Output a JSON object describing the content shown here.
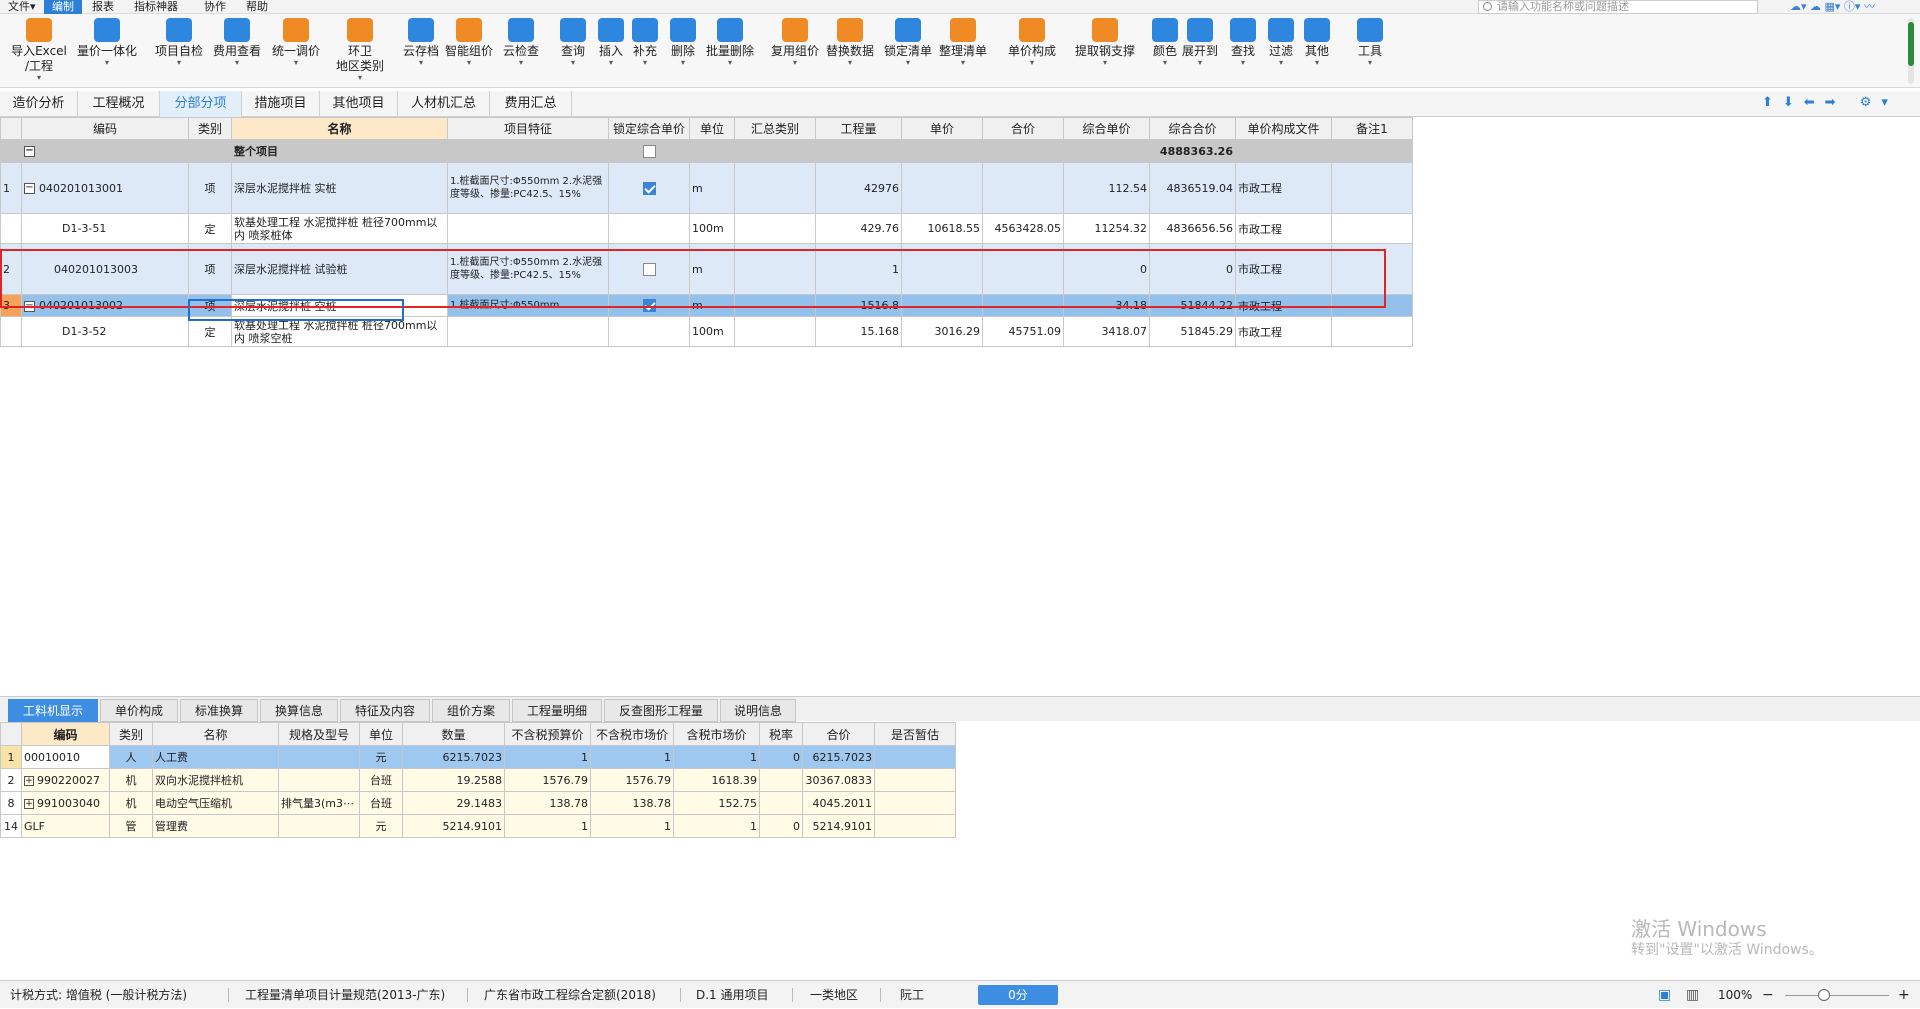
{
  "menu": [
    "文件▾",
    "编制",
    "报表",
    "指标神器",
    "协作",
    "帮助"
  ],
  "search": {
    "placeholder": "请输入功能名称或问题描述"
  },
  "ribbon": [
    {
      "label": "导入Excel",
      "label2": "/工程",
      "icon": "import-excel-icon",
      "color": "orange"
    },
    {
      "label": "量价一体化",
      "icon": "price-integration-icon",
      "color": "blue"
    },
    {
      "label": "项目自检",
      "icon": "self-check-icon",
      "color": "blue"
    },
    {
      "label": "费用查看",
      "icon": "fee-view-icon",
      "color": "blue"
    },
    {
      "label": "统一调价",
      "icon": "adjust-price-icon",
      "color": "orange"
    },
    {
      "label": "环卫",
      "label2": "地区类别",
      "icon": "region-icon",
      "color": "orange"
    },
    {
      "label": "云存档",
      "icon": "cloud-save-icon",
      "color": "blue"
    },
    {
      "label": "智能组价",
      "icon": "smart-price-icon",
      "color": "orange"
    },
    {
      "label": "云检查",
      "icon": "cloud-check-icon",
      "color": "blue"
    },
    {
      "label": "查询",
      "icon": "query-icon",
      "color": "blue"
    },
    {
      "label": "插入",
      "icon": "insert-icon",
      "color": "blue"
    },
    {
      "label": "补充",
      "icon": "supplement-icon",
      "color": "blue"
    },
    {
      "label": "删除",
      "icon": "delete-icon",
      "color": "blue"
    },
    {
      "label": "批量删除",
      "icon": "batch-delete-icon",
      "color": "blue"
    },
    {
      "label": "复用组价",
      "icon": "reuse-price-icon",
      "color": "orange"
    },
    {
      "label": "替换数据",
      "icon": "replace-data-icon",
      "color": "orange"
    },
    {
      "label": "锁定清单",
      "icon": "lock-list-icon",
      "color": "blue"
    },
    {
      "label": "整理清单",
      "icon": "organize-list-icon",
      "color": "orange"
    },
    {
      "label": "单价构成",
      "icon": "unit-price-icon",
      "color": "orange"
    },
    {
      "label": "提取钢支撑",
      "icon": "steel-support-icon",
      "color": "orange"
    },
    {
      "label": "颜色",
      "icon": "color-icon",
      "color": "blue"
    },
    {
      "label": "展开到",
      "icon": "expand-icon",
      "color": "blue"
    },
    {
      "label": "查找",
      "icon": "find-icon",
      "color": "blue"
    },
    {
      "label": "过滤",
      "icon": "filter-icon",
      "color": "blue"
    },
    {
      "label": "其他",
      "icon": "other-icon",
      "color": "blue"
    },
    {
      "label": "工具",
      "icon": "tools-icon",
      "color": "blue"
    }
  ],
  "tabs": [
    "造价分析",
    "工程概况",
    "分部分项",
    "措施项目",
    "其他项目",
    "人材机汇总",
    "费用汇总"
  ],
  "grid": {
    "headers": [
      "编码",
      "类别",
      "名称",
      "项目特征",
      "锁定综合单价",
      "单位",
      "汇总类别",
      "工程量",
      "单价",
      "合价",
      "综合单价",
      "综合合价",
      "单价构成文件",
      "备注1"
    ],
    "root": {
      "name": "整个项目",
      "total": "4888363.26"
    },
    "rows": [
      {
        "no": "1",
        "code": "040201013001",
        "type": "项",
        "name": "深层水泥搅拌桩 实桩",
        "feature": "1.桩截面尺寸:Φ550mm\n2.水泥强度等级、掺量:PC42.5、15%",
        "locked": true,
        "unit": "m",
        "qty": "42976",
        "price": "",
        "amount": "",
        "uprice": "112.54",
        "utotal": "4836519.04",
        "file": "市政工程"
      },
      {
        "no": "",
        "code": "D1-3-51",
        "type": "定",
        "name": "软基处理工程 水泥搅拌桩 桩径700mm以内 喷浆桩体",
        "feature": "",
        "unit": "100m",
        "qty": "429.76",
        "price": "10618.55",
        "amount": "4563428.05",
        "uprice": "11254.32",
        "utotal": "4836656.56",
        "file": "市政工程"
      },
      {
        "no": "2",
        "code": "040201013003",
        "type": "项",
        "name": "深层水泥搅拌桩 试验桩",
        "feature": "1.桩截面尺寸:Φ550mm\n2.水泥强度等级、掺量:PC42.5、15%",
        "locked": false,
        "unit": "m",
        "qty": "1",
        "price": "",
        "amount": "",
        "uprice": "0",
        "utotal": "0",
        "file": "市政工程"
      },
      {
        "no": "3",
        "code": "040201013002",
        "type": "项",
        "name": "深层水泥搅拌桩 空桩",
        "feature": "1.桩截面尺寸:Φ550mm",
        "locked": true,
        "unit": "m",
        "qty": "1516.8",
        "price": "",
        "amount": "",
        "uprice": "34.18",
        "utotal": "51844.22",
        "file": "市政工程"
      },
      {
        "no": "",
        "code": "D1-3-52",
        "type": "定",
        "name": "软基处理工程 水泥搅拌桩 桩径700mm以内 喷浆空桩",
        "feature": "",
        "unit": "100m",
        "qty": "15.168",
        "price": "3016.29",
        "amount": "45751.09",
        "uprice": "3418.07",
        "utotal": "51845.29",
        "file": "市政工程"
      }
    ]
  },
  "bottom_tabs": [
    "工料机显示",
    "单价构成",
    "标准换算",
    "换算信息",
    "特征及内容",
    "组价方案",
    "工程量明细",
    "反查图形工程量",
    "说明信息"
  ],
  "grid2": {
    "headers": [
      "编码",
      "类别",
      "名称",
      "规格及型号",
      "单位",
      "数量",
      "不含税预算价",
      "不含税市场价",
      "含税市场价",
      "税率",
      "合价",
      "是否暂估"
    ],
    "rows": [
      {
        "no": "1",
        "code": "00010010",
        "type": "人",
        "name": "人工费",
        "spec": "",
        "unit": "元",
        "qty": "6215.7023",
        "p1": "1",
        "p2": "1",
        "p3": "1",
        "tax": "0",
        "total": "6215.7023"
      },
      {
        "no": "2",
        "code": "990220027",
        "type": "机",
        "name": "双向水泥搅拌桩机",
        "spec": "",
        "unit": "台班",
        "qty": "19.2588",
        "p1": "1576.79",
        "p2": "1576.79",
        "p3": "1618.39",
        "tax": "",
        "total": "30367.0833"
      },
      {
        "no": "8",
        "code": "991003040",
        "type": "机",
        "name": "电动空气压缩机",
        "spec": "排气量3(m3⋯",
        "unit": "台班",
        "qty": "29.1483",
        "p1": "138.78",
        "p2": "138.78",
        "p3": "152.75",
        "tax": "",
        "total": "4045.2011"
      },
      {
        "no": "14",
        "code": "GLF",
        "type": "管",
        "name": "管理费",
        "spec": "",
        "unit": "元",
        "qty": "5214.9101",
        "p1": "1",
        "p2": "1",
        "p3": "1",
        "tax": "0",
        "total": "5214.9101"
      }
    ]
  },
  "watermark": {
    "line1": "激活 Windows",
    "line2": "转到\"设置\"以激活 Windows。"
  },
  "status": {
    "tax": "计税方式: 增值税 (一般计税方法)",
    "spec": "工程量清单项目计量规范(2013-广东)",
    "quota": "广东省市政工程综合定额(2018)",
    "general": "D.1 通用项目",
    "region": "一类地区",
    "user": "阮工",
    "score": "0分",
    "zoom": "100%"
  }
}
